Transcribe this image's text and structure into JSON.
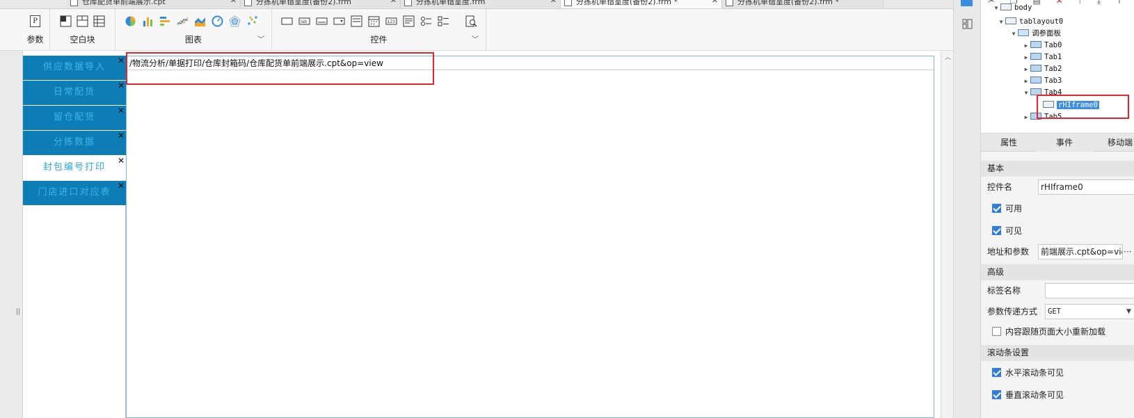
{
  "document_tabs": [
    {
      "title": "仓库配货单前端展示.cpt",
      "active": false
    },
    {
      "title": "分拣机单错呈度(备份2).frm",
      "active": false
    },
    {
      "title": "分拣机单错呈度.frm",
      "active": false
    },
    {
      "title": "分拣机单错呈度(备份2).frm *",
      "active": true
    },
    {
      "title": "分拣机单错呈度(备份2).frm *",
      "active": false
    }
  ],
  "ribbon": {
    "groups": {
      "params": "参数",
      "blank": "空白块",
      "chart": "图表",
      "widget": "控件"
    }
  },
  "nav_tabs": [
    {
      "label": "供应数据导入",
      "active": false
    },
    {
      "label": "日常配货",
      "active": false
    },
    {
      "label": "留仓配货",
      "active": false
    },
    {
      "label": "分拣数据",
      "active": false
    },
    {
      "label": "封包编号打印",
      "active": true
    },
    {
      "label": "门店进口对应表",
      "active": false
    }
  ],
  "nav_close_glyph": "✕",
  "iframe": {
    "url": "/物流分析/单据打印/仓库封箱码/仓库配货单前端展示.cpt&op=view"
  },
  "tree": {
    "nodes": [
      {
        "label": "body",
        "level": 0
      },
      {
        "label": "tablayout0",
        "level": 1
      },
      {
        "label": "调参面板",
        "level": 2
      },
      {
        "label": "Tab0",
        "level": 3
      },
      {
        "label": "Tab1",
        "level": 3
      },
      {
        "label": "Tab2",
        "level": 3
      },
      {
        "label": "Tab3",
        "level": 3
      },
      {
        "label": "Tab4",
        "level": 3
      },
      {
        "label": "rHIframe0",
        "level": 4
      },
      {
        "label": "Tab5",
        "level": 3
      }
    ]
  },
  "panel_tabs": [
    "属性",
    "事件",
    "移动端"
  ],
  "properties": {
    "basic_section": "基本",
    "widget_name_label": "控件名",
    "widget_name_value": "rHIframe0",
    "enabled_label": "可用",
    "enabled": true,
    "visible_label": "可见",
    "visible": true,
    "url_label": "地址和参数",
    "url_value": "前端展示.cpt&op=view",
    "url_more": "···",
    "advanced_section": "高级",
    "tag_name_label": "标签名称",
    "tag_name_value": "",
    "param_method_label": "参数传递方式",
    "param_method_value": "GET",
    "reload_label": "内容跟随页面大小重新加载",
    "reload": false,
    "scroll_section": "滚动条设置",
    "h_scroll_label": "水平滚动条可见",
    "h_scroll": true,
    "v_scroll_label": "垂直滚动条可见",
    "v_scroll": true
  },
  "colors": {
    "nav_bg": "#0e7db5",
    "nav_text": "#3fb6e8",
    "highlight_red": "#e8232b",
    "selection_blue": "#3a8ee6"
  }
}
